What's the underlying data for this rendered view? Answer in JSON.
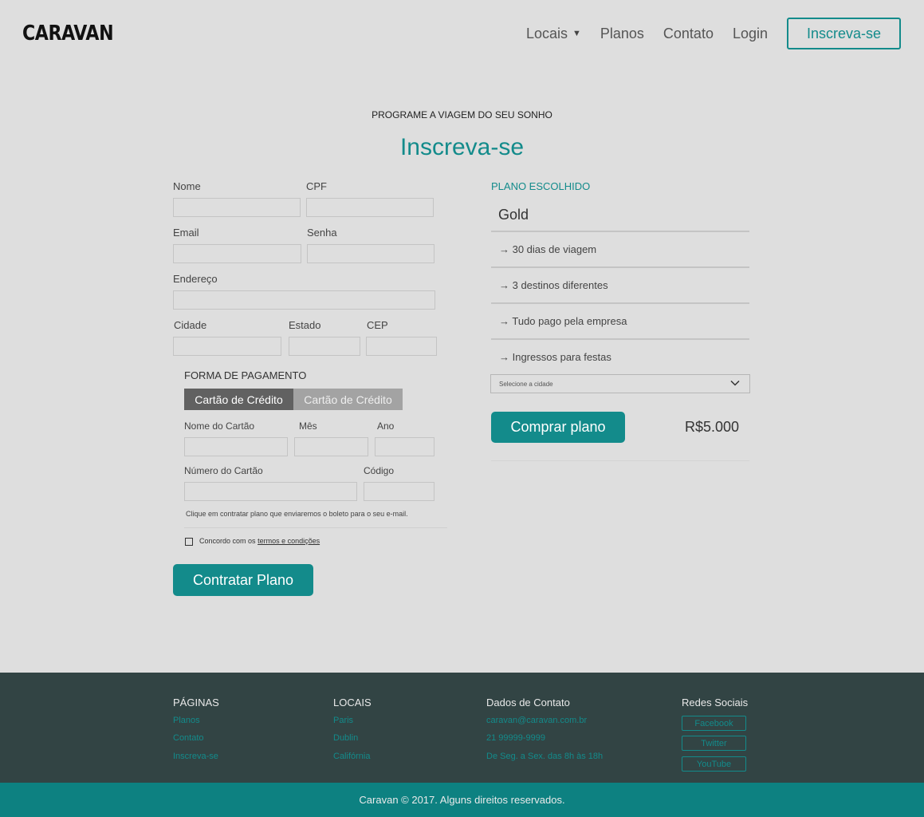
{
  "header": {
    "logo": "CARAVAN",
    "nav": [
      "Locais",
      "Planos",
      "Contato",
      "Login"
    ],
    "signup_label": "Inscreva-se"
  },
  "hero": {
    "subtitle": "PROGRAME A VIAGEM DO SEU SONHO",
    "title": "Inscreva-se"
  },
  "form": {
    "nome": "Nome",
    "cpf": "CPF",
    "email": "Email",
    "senha": "Senha",
    "endereco": "Endereço",
    "cidade": "Cidade",
    "estado": "Estado",
    "cep": "CEP",
    "payment_label": "FORMA DE PAGAMENTO",
    "payment_tabs": [
      "Cartão de Crédito",
      "Cartão de Crédito"
    ],
    "nome_cartao": "Nome do Cartão",
    "mes": "Mês",
    "ano": "Ano",
    "numero_cartao": "Número do Cartão",
    "codigo": "Código",
    "note": "Clique em contratar plano que enviaremos o boleto para o seu e-mail.",
    "agree_prefix": "Concordo com os",
    "agree_link": "termos e condições",
    "submit_label": "Contratar Plano"
  },
  "plan": {
    "heading": "PLANO ESCOLHIDO",
    "name": "Gold",
    "items": [
      "→ 30 dias de viagem",
      "→ 3 destinos diferentes",
      "→ Tudo pago pela empresa",
      "→ Ingressos para festas"
    ],
    "select_placeholder": "Selecione a cidade",
    "buy_label": "Comprar plano",
    "price": "R$5.000"
  },
  "footer": {
    "paginas": {
      "title": "PÁGINAS",
      "links": [
        "Planos",
        "Contato",
        "Inscreva-se"
      ]
    },
    "locais": {
      "title": "LOCAIS",
      "links": [
        "Paris",
        "Dublin",
        "Califórnia"
      ]
    },
    "contato": {
      "title": "Dados de Contato",
      "lines": [
        "caravan@caravan.com.br",
        "21 99999-9999",
        "De Seg. a Sex. das 8h às 18h"
      ]
    },
    "redes": {
      "title": "Redes Sociais",
      "links": [
        "Facebook",
        "Twitter",
        "YouTube"
      ]
    },
    "copyright": "Caravan © 2017. Alguns direitos reservados."
  },
  "colors": {
    "accent": "#138b8b",
    "footer_bg": "#324444",
    "copyright_bg": "#0d8181",
    "page_bg": "#dedede"
  }
}
